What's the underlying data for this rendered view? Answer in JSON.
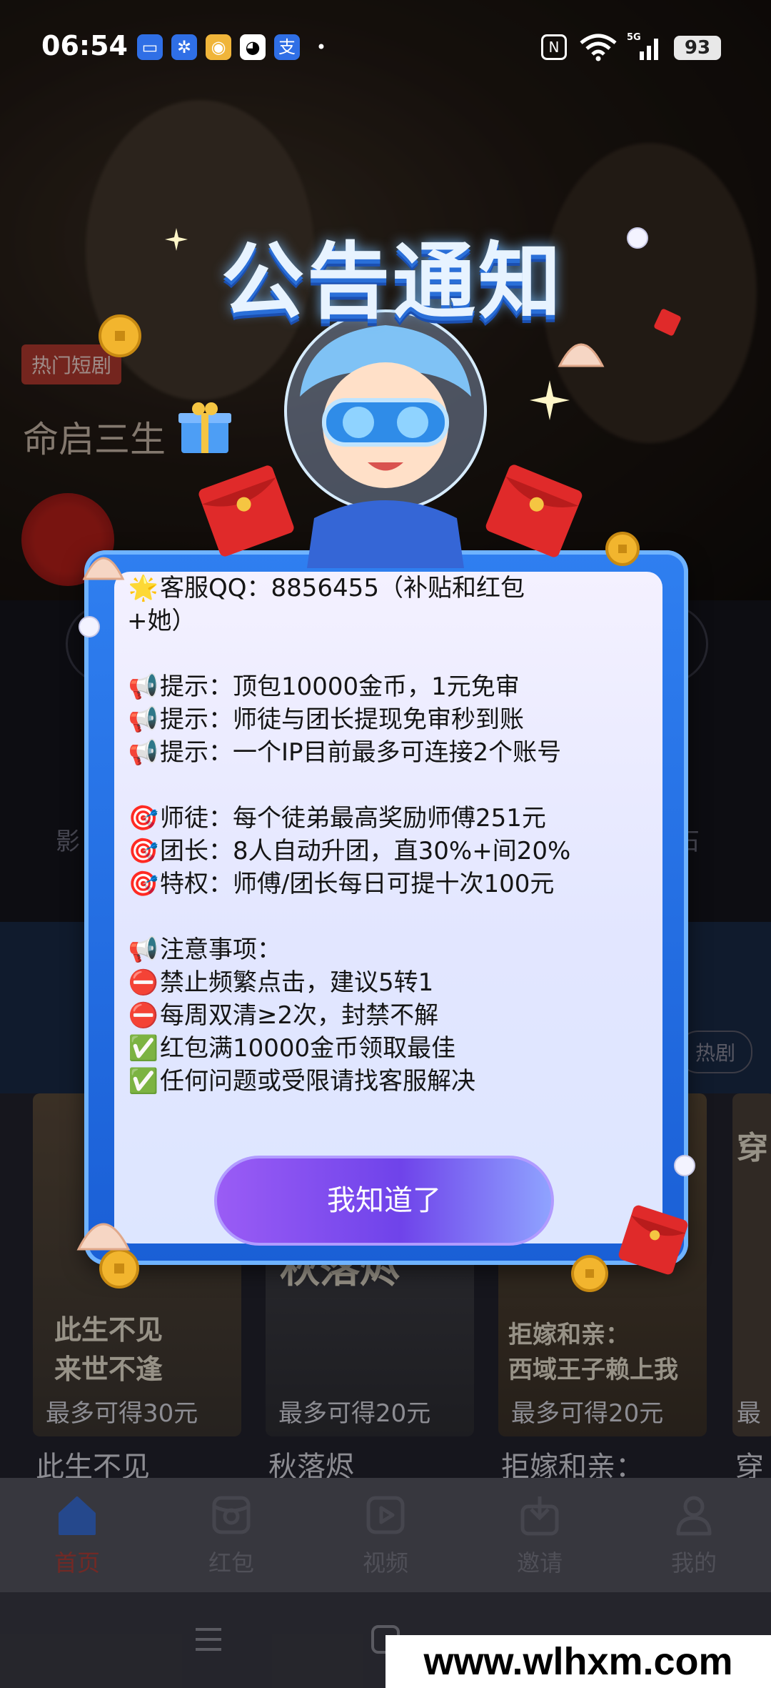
{
  "status_bar": {
    "time": "06:54",
    "battery": "93",
    "network": "5G"
  },
  "background": {
    "hot_tag": "热门短剧",
    "hero_title": "命启三生",
    "side_left": "影",
    "side_right": "石",
    "hot_pill": "热剧",
    "posters": [
      {
        "art_text": "此生不见\n来世不逢",
        "reward": "最多可得30元",
        "title": "此生不见"
      },
      {
        "art_text": "秋落烬",
        "reward": "最多可得20元",
        "title": "秋落烬"
      },
      {
        "art_text": "拒嫁和亲：\n西域王子赖上我",
        "reward": "最多可得20元",
        "title": "拒嫁和亲："
      },
      {
        "art_text": "穿",
        "reward": "最",
        "title": "穿"
      }
    ]
  },
  "tabbar": {
    "items": [
      {
        "label": "首页",
        "icon": "home-icon",
        "active": true
      },
      {
        "label": "红包",
        "icon": "red-packet-icon",
        "active": false
      },
      {
        "label": "视频",
        "icon": "video-icon",
        "active": false
      },
      {
        "label": "邀请",
        "icon": "invite-icon",
        "active": false
      },
      {
        "label": "我的",
        "icon": "profile-icon",
        "active": false
      }
    ]
  },
  "modal": {
    "title": "公告通知",
    "lines": [
      {
        "emoji": "🌟",
        "text": "客服QQ：8856455（补贴和红包"
      },
      {
        "emoji": "",
        "text": "+她）"
      },
      {
        "emoji": "📢",
        "text": "提示：顶包10000金币，1元免审"
      },
      {
        "emoji": "📢",
        "text": "提示：师徒与团长提现免审秒到账"
      },
      {
        "emoji": "📢",
        "text": "提示：一个IP目前最多可连接2个账号"
      },
      {
        "emoji": "🎯",
        "text": "师徒：每个徒弟最高奖励师傅251元"
      },
      {
        "emoji": "🎯",
        "text": "团长：8人自动升团，直30%+间20%"
      },
      {
        "emoji": "🎯",
        "text": "特权：师傅/团长每日可提十次100元"
      },
      {
        "emoji": "📢",
        "text": "注意事项："
      },
      {
        "emoji": "⛔",
        "text": "禁止频繁点击，建议5转1"
      },
      {
        "emoji": "⛔",
        "text": "每周双清≥2次，封禁不解"
      },
      {
        "emoji": "✅",
        "text": "红包满10000金币领取最佳"
      },
      {
        "emoji": "✅",
        "text": "任何问题或受限请找客服解决"
      }
    ],
    "confirm_label": "我知道了"
  },
  "watermark": "www.wlhxm.com",
  "colors": {
    "modal_blue": "#2f7ff0",
    "button_purple": "#7a4af0",
    "active_tab": "#b0403a"
  }
}
